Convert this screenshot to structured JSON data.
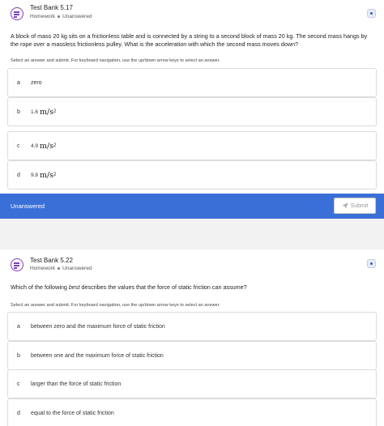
{
  "questions": [
    {
      "title": "Test Bank 5.17",
      "type": "Homework",
      "status": "Unanswered",
      "text": "A block of mass 20 kg sits on a frictionless table and is connected by a string to a second block of mass 20 kg. The second mass hangs by the rope over a massless frictionless pulley. What is the acceleration with which the second mass moves down?",
      "instructions": "Select an answer and submit. For keyboard navigation, use the up/down arrow keys to select an answer.",
      "options": [
        {
          "letter": "a",
          "text": "zero"
        },
        {
          "letter": "b",
          "num": "1.6",
          "unit": "m/s",
          "exp": "2"
        },
        {
          "letter": "c",
          "num": "4.9",
          "unit": "m/s",
          "exp": "2"
        },
        {
          "letter": "d",
          "num": "9.8",
          "unit": "m/s",
          "exp": "2"
        }
      ],
      "footer_status": "Unanswered",
      "submit_label": "Submit"
    },
    {
      "title": "Test Bank 5.22",
      "type": "Homework",
      "status": "Unanswered",
      "text_before": "Which of the following ",
      "text_em": "best",
      "text_after": " describes the values that the force of static friction can assume?",
      "instructions": "Select an answer and submit. For keyboard navigation, use the up/down arrow keys to select an answer.",
      "options": [
        {
          "letter": "a",
          "text": "between zero and the maximum force of static friction"
        },
        {
          "letter": "b",
          "text": "between one and the maximum force of static friction"
        },
        {
          "letter": "c",
          "text": "larger than the force of static friction"
        },
        {
          "letter": "d",
          "text": "equal to the force of static friction"
        }
      ]
    }
  ],
  "colors": {
    "accent": "#3b6fd8",
    "icon": "#7b3fbf"
  },
  "icons": {
    "question": "question-list-icon",
    "info": "info-icon",
    "submit": "send-icon"
  }
}
